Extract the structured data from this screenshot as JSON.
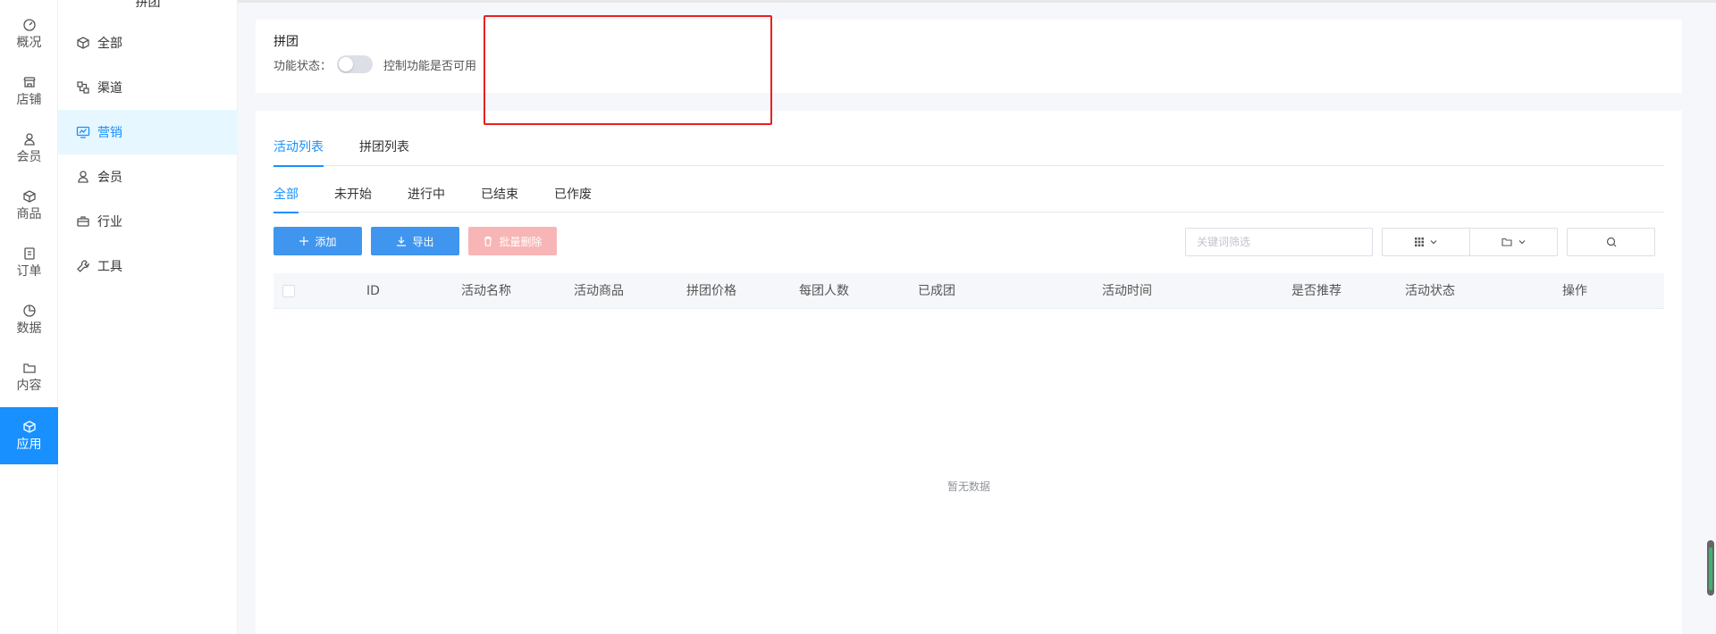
{
  "rail": {
    "items": [
      {
        "label": "概况",
        "icon": "dashboard-icon"
      },
      {
        "label": "店铺",
        "icon": "store-icon"
      },
      {
        "label": "会员",
        "icon": "user-icon"
      },
      {
        "label": "商品",
        "icon": "box-icon"
      },
      {
        "label": "订单",
        "icon": "order-icon"
      },
      {
        "label": "数据",
        "icon": "pie-chart-icon"
      },
      {
        "label": "内容",
        "icon": "folder-icon"
      },
      {
        "label": "应用",
        "icon": "app-icon",
        "active": true
      }
    ]
  },
  "submenu": {
    "title": "拼团",
    "items": [
      {
        "label": "全部",
        "icon": "cube-icon"
      },
      {
        "label": "渠道",
        "icon": "channel-icon"
      },
      {
        "label": "营销",
        "icon": "marketing-icon",
        "active": true
      },
      {
        "label": "会员",
        "icon": "user-icon"
      },
      {
        "label": "行业",
        "icon": "briefcase-icon"
      },
      {
        "label": "工具",
        "icon": "wrench-icon"
      }
    ]
  },
  "feature": {
    "title": "拼团",
    "status_label": "功能状态：",
    "switch_on": false,
    "hint": "控制功能是否可用"
  },
  "tabs": [
    {
      "label": "活动列表",
      "active": true
    },
    {
      "label": "拼团列表",
      "active": false
    }
  ],
  "status_tabs": [
    {
      "label": "全部",
      "active": true
    },
    {
      "label": "未开始",
      "active": false
    },
    {
      "label": "进行中",
      "active": false
    },
    {
      "label": "已结束",
      "active": false
    },
    {
      "label": "已作废",
      "active": false
    }
  ],
  "toolbar": {
    "add_label": "添加",
    "export_label": "导出",
    "batch_delete_label": "批量删除",
    "search_placeholder": "关键词筛选"
  },
  "table": {
    "columns": [
      "ID",
      "活动名称",
      "活动商品",
      "拼团价格",
      "每团人数",
      "已成团",
      "活动时间",
      "是否推荐",
      "活动状态",
      "操作"
    ],
    "empty_text": "暂无数据"
  },
  "colors": {
    "primary": "#1890ff",
    "button_primary": "#4096ee",
    "button_danger_disabled": "#f8b5b5",
    "highlight": "#e82020"
  }
}
